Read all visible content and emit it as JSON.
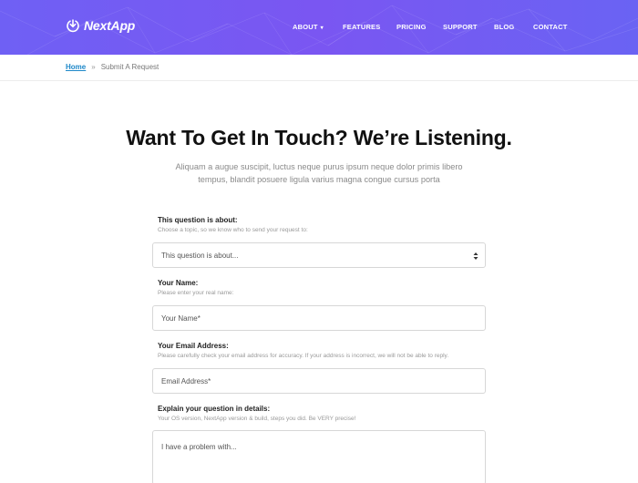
{
  "brand": {
    "name": "NextApp"
  },
  "nav": {
    "items": [
      {
        "label": "ABOUT",
        "has_dropdown": true
      },
      {
        "label": "FEATURES"
      },
      {
        "label": "PRICING"
      },
      {
        "label": "SUPPORT"
      },
      {
        "label": "BLOG"
      },
      {
        "label": "CONTACT"
      }
    ]
  },
  "breadcrumb": {
    "home": "Home",
    "separator": "»",
    "current": "Submit A Request"
  },
  "hero": {
    "title": "Want To Get In Touch? We’re Listening.",
    "subtitle_line1": "Aliquam a augue suscipit, luctus neque purus ipsum neque dolor primis libero",
    "subtitle_line2": "tempus, blandit posuere ligula varius magna congue cursus porta"
  },
  "form": {
    "topic": {
      "label": "This question is about:",
      "help": "Choose a topic, so we know who to send your request to:",
      "selected": "This question is about..."
    },
    "name": {
      "label": "Your Name:",
      "help": "Please enter your real name:",
      "placeholder": "Your Name*"
    },
    "email": {
      "label": "Your Email Address:",
      "help": "Please carefully check your email address for accuracy. If your address is incorrect, we will not be able to reply.",
      "placeholder": "Email Address*"
    },
    "details": {
      "label": "Explain your question in details:",
      "help": "Your OS version, NextApp version & build, steps you did. Be VERY precise!",
      "placeholder": "I have a problem with..."
    }
  },
  "colors": {
    "header_start": "#6f60f4",
    "header_end": "#6a63f3",
    "link": "#1e88c9"
  },
  "icons": {
    "logo": "download-circle-icon",
    "select": "select-arrows-icon"
  }
}
